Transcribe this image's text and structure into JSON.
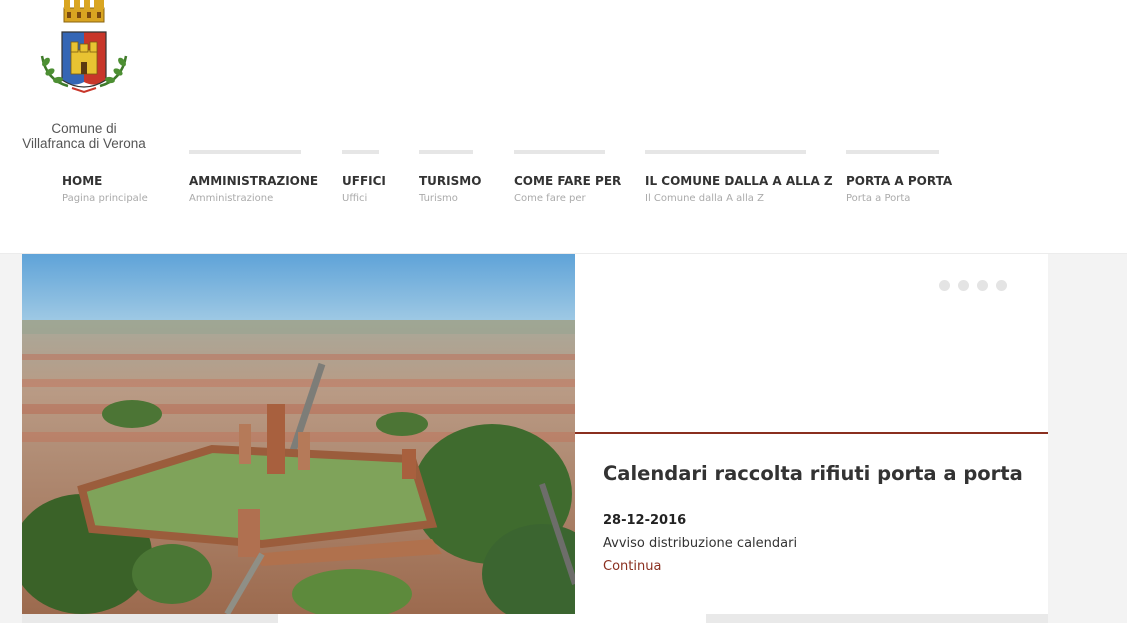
{
  "logo": {
    "line1": "Comune di",
    "line2": "Villafranca di Verona"
  },
  "nav": {
    "items": [
      {
        "label": "HOME",
        "sub": "Pagina principale"
      },
      {
        "label": "AMMINISTRAZIONE",
        "sub": "Amministrazione"
      },
      {
        "label": "UFFICI",
        "sub": "Uffici"
      },
      {
        "label": "TURISMO",
        "sub": "Turismo"
      },
      {
        "label": "COME FARE PER",
        "sub": "Come fare per"
      },
      {
        "label": "IL COMUNE DALLA A ALLA Z",
        "sub": "Il Comune dalla A alla Z"
      },
      {
        "label": "PORTA A PORTA",
        "sub": "Porta a Porta"
      }
    ]
  },
  "slider": {
    "dot_count": 4,
    "title": "Calendari raccolta rifiuti porta a porta",
    "date": "28-12-2016",
    "description": "Avviso distribuzione calendari",
    "link": "Continua"
  },
  "colors": {
    "accent": "#8a2f1f",
    "nav_text": "#333333",
    "nav_sub": "#aaaaaa",
    "background": "#f3f3f3"
  }
}
